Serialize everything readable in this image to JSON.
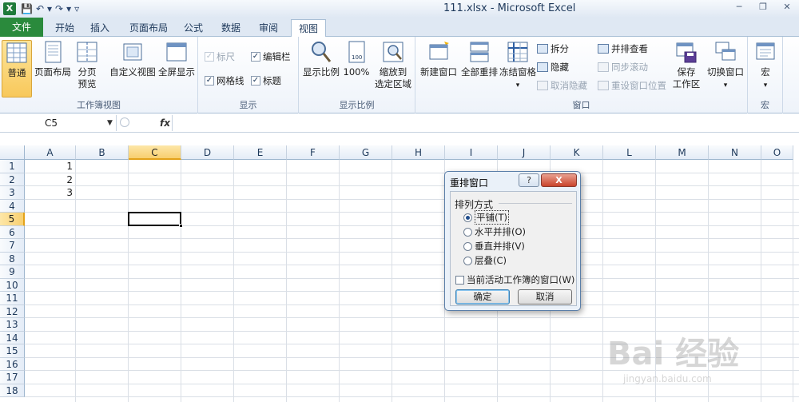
{
  "titlebar": {
    "logo": "X",
    "title": "111.xlsx  -  Microsoft Excel",
    "qat": [
      "save-icon",
      "undo-icon",
      "redo-icon",
      "customize-icon"
    ],
    "controls": [
      "minimize",
      "restore",
      "close"
    ]
  },
  "tabs": [
    {
      "label": "文件"
    },
    {
      "label": "开始"
    },
    {
      "label": "插入"
    },
    {
      "label": "页面布局"
    },
    {
      "label": "公式"
    },
    {
      "label": "数据"
    },
    {
      "label": "审阅"
    },
    {
      "label": "视图"
    }
  ],
  "ribbon": {
    "workbook_views": {
      "normal": "普通",
      "page_layout": "页面布局",
      "page_break_1": "分页",
      "page_break_2": "预览",
      "custom_view": "自定义视图",
      "full_screen": "全屏显示",
      "group_label": "工作簿视图"
    },
    "show": {
      "ruler": "标尺",
      "formula_bar": "编辑栏",
      "gridlines": "网格线",
      "headings": "标题",
      "group_label": "显示"
    },
    "zoom": {
      "zoom": "显示比例",
      "hundred": "100%",
      "zoom_sel_1": "缩放到",
      "zoom_sel_2": "选定区域",
      "group_label": "显示比例"
    },
    "window": {
      "new_window": "新建窗口",
      "arrange_all": "全部重排",
      "freeze": "冻结窗格",
      "split": "拆分",
      "hide": "隐藏",
      "unhide": "取消隐藏",
      "side_by_side": "并排查看",
      "sync_scroll": "同步滚动",
      "reset_pos": "重设窗口位置",
      "save_ws_1": "保存",
      "save_ws_2": "工作区",
      "switch": "切换窗口",
      "group_label": "窗口"
    },
    "macros": {
      "macros": "宏",
      "group_label": "宏"
    }
  },
  "formula_bar": {
    "name_box": "C5",
    "fx": "fx",
    "formula": ""
  },
  "sheet": {
    "columns": [
      "A",
      "B",
      "C",
      "D",
      "E",
      "F",
      "G",
      "H",
      "I",
      "J",
      "K",
      "L",
      "M",
      "N",
      "O"
    ],
    "rows": [
      "1",
      "2",
      "3",
      "4",
      "5",
      "6",
      "7",
      "8",
      "9",
      "10",
      "11",
      "12",
      "13",
      "14",
      "15",
      "16",
      "17",
      "18"
    ],
    "selected_column": "C",
    "selected_row": "5",
    "cells": [
      {
        "ref": "A1",
        "value": "1"
      },
      {
        "ref": "A2",
        "value": "2"
      },
      {
        "ref": "A3",
        "value": "3"
      }
    ]
  },
  "dialog": {
    "title": "重排窗口",
    "help": "?",
    "close": "X",
    "section": "排列方式",
    "options": [
      {
        "label": "平铺(T)",
        "selected": true
      },
      {
        "label": "水平并排(O)",
        "selected": false
      },
      {
        "label": "垂直并排(V)",
        "selected": false
      },
      {
        "label": "层叠(C)",
        "selected": false
      }
    ],
    "checkbox": "当前活动工作簿的窗口(W)",
    "ok": "确定",
    "cancel": "取消"
  },
  "watermark": {
    "main": "Bai 经验",
    "sub": "jingyan.baidu.com"
  }
}
